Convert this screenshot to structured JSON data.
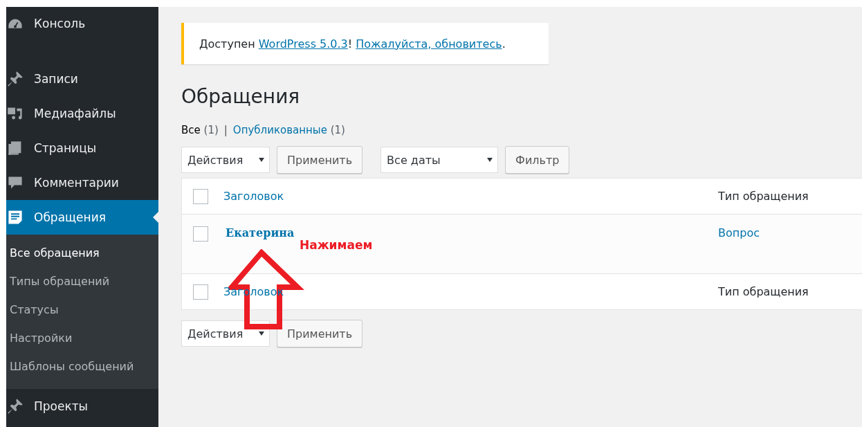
{
  "sidebar": {
    "items": [
      {
        "label": "Консоль",
        "selected": false
      },
      {
        "label": "Записи",
        "selected": false
      },
      {
        "label": "Медиафайлы",
        "selected": false
      },
      {
        "label": "Страницы",
        "selected": false
      },
      {
        "label": "Комментарии",
        "selected": false
      },
      {
        "label": "Обращения",
        "selected": true,
        "children": [
          {
            "label": "Все обращения",
            "selected": true
          },
          {
            "label": "Типы обращений",
            "selected": false
          },
          {
            "label": "Статусы",
            "selected": false
          },
          {
            "label": "Настройки",
            "selected": false
          },
          {
            "label": "Шаблоны сообщений",
            "selected": false
          }
        ]
      },
      {
        "label": "Проекты",
        "selected": false
      }
    ]
  },
  "notice": {
    "parts": [
      {
        "kind": "text",
        "text": "Доступен "
      },
      {
        "kind": "link",
        "text": "WordPress 5.0.3"
      },
      {
        "kind": "text",
        "text": "! "
      },
      {
        "kind": "link",
        "text": "Пожалуйста, обновитесь"
      },
      {
        "kind": "text",
        "text": "."
      }
    ]
  },
  "page_title": "Обращения",
  "views": {
    "items": [
      {
        "label": "Все",
        "count": "(1)",
        "selected": true
      },
      {
        "label": "Опубликованные",
        "count": "(1)",
        "selected": false
      }
    ],
    "separator": "|"
  },
  "tablenav_top": {
    "bulk_action": "Действия",
    "apply": "Применить",
    "date_filter": "Все даты",
    "filter": "Фильтр"
  },
  "table": {
    "header": {
      "checked": false,
      "columns": [
        "Заголовок",
        "Тип обращения"
      ]
    },
    "rows": [
      {
        "checked": false,
        "title": "Екатерина",
        "type": "Вопрос"
      }
    ],
    "footer": {
      "checked": false,
      "columns": [
        "Заголовок",
        "Тип обращения"
      ]
    }
  },
  "tablenav_bottom": {
    "bulk_action": "Действия",
    "apply": "Применить"
  },
  "annotation": {
    "label": "Нажимаем"
  }
}
